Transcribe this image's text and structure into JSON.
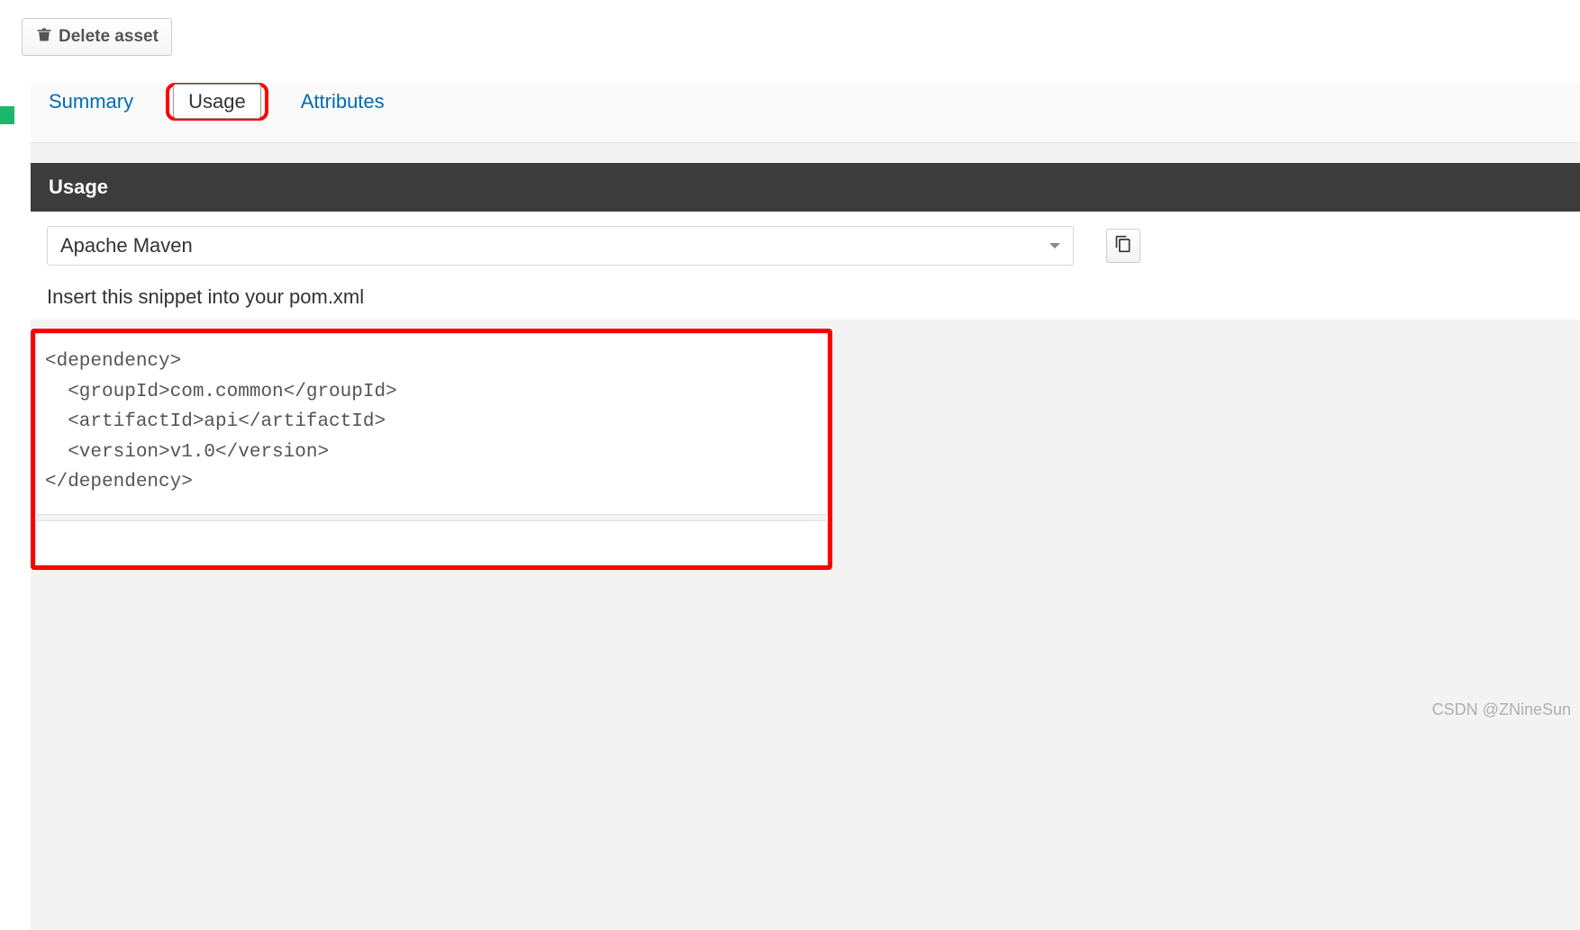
{
  "toolbar": {
    "delete_label": "Delete asset"
  },
  "tabs": {
    "summary": "Summary",
    "usage": "Usage",
    "attributes": "Attributes"
  },
  "panel": {
    "title": "Usage",
    "select_value": "Apache Maven",
    "hint": "Insert this snippet into your pom.xml",
    "snippet": "<dependency>\n  <groupId>com.common</groupId>\n  <artifactId>api</artifactId>\n  <version>v1.0</version>\n</dependency>"
  },
  "watermark": "CSDN @ZNineSun"
}
